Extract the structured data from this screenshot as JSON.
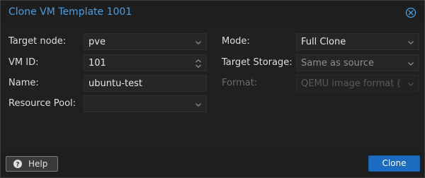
{
  "dialog": {
    "title": "Clone VM Template 1001"
  },
  "form": {
    "target_node": {
      "label": "Target node:",
      "value": "pve"
    },
    "vm_id": {
      "label": "VM ID:",
      "value": "101"
    },
    "name": {
      "label": "Name:",
      "value": "ubuntu-test"
    },
    "resource_pool": {
      "label": "Resource Pool:",
      "value": ""
    },
    "mode": {
      "label": "Mode:",
      "value": "Full Clone"
    },
    "target_storage": {
      "label": "Target Storage:",
      "value": "Same as source"
    },
    "format": {
      "label": "Format:",
      "value": "QEMU image format (qc"
    }
  },
  "footer": {
    "help_label": "Help",
    "clone_label": "Clone"
  },
  "icons": {
    "close": "close-icon",
    "help": "question-circle-icon",
    "dropdown": "chevron-down-icon",
    "spinner": "spinner-arrows-icon"
  },
  "colors": {
    "title": "#4c9ce0",
    "primary_button": "#1b6bc0"
  }
}
